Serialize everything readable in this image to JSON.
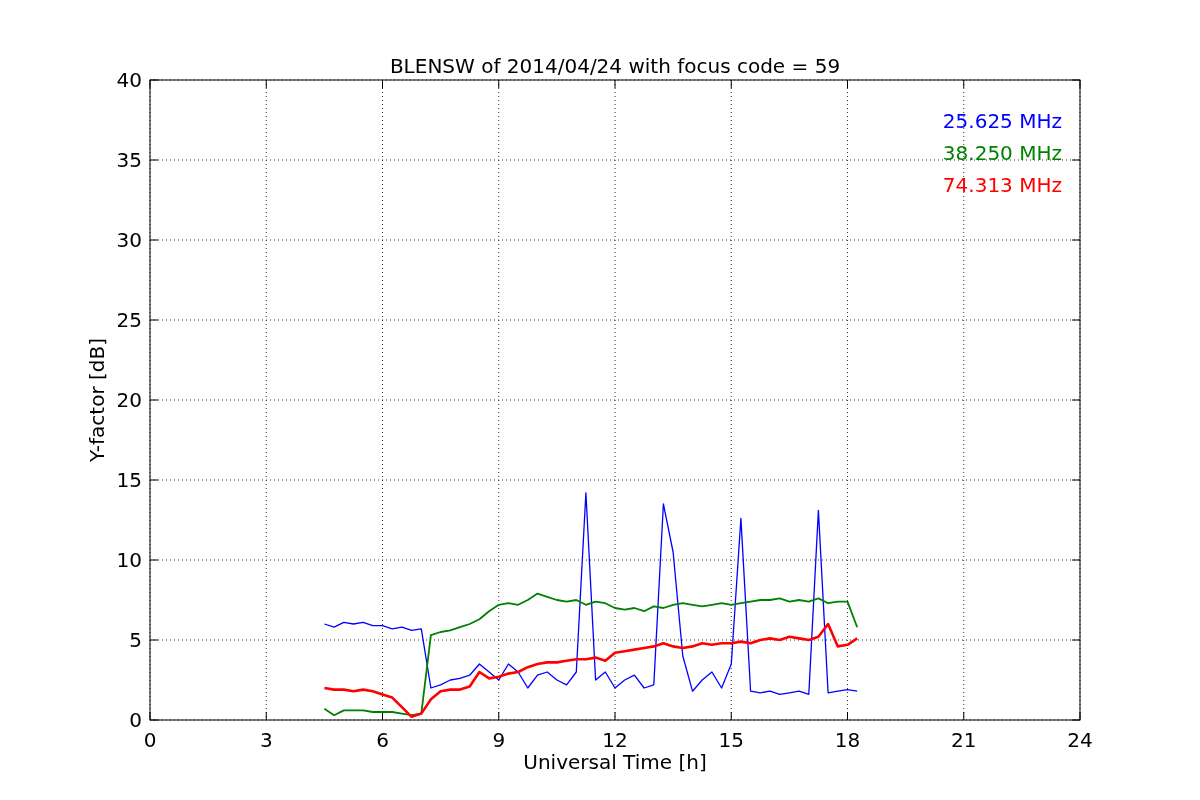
{
  "figure": {
    "chart_data": {
      "type": "line",
      "title": "BLENSW of 2014/04/24 with focus code = 59",
      "xlabel": "Universal Time [h]",
      "ylabel": "Y-factor [dB]",
      "xlim": [
        0,
        24
      ],
      "ylim": [
        0,
        40
      ],
      "xticks": [
        0,
        3,
        6,
        9,
        12,
        15,
        18,
        21,
        24
      ],
      "yticks": [
        0,
        5,
        10,
        15,
        20,
        25,
        30,
        35,
        40
      ],
      "grid": true,
      "x": [
        4.5,
        4.75,
        5,
        5.25,
        5.5,
        5.75,
        6,
        6.25,
        6.5,
        6.75,
        7,
        7.25,
        7.5,
        7.75,
        8,
        8.25,
        8.5,
        8.75,
        9,
        9.25,
        9.5,
        9.75,
        10,
        10.25,
        10.5,
        10.75,
        11,
        11.25,
        11.5,
        11.75,
        12,
        12.25,
        12.5,
        12.75,
        13,
        13.25,
        13.5,
        13.75,
        14,
        14.25,
        14.5,
        14.75,
        15,
        15.25,
        15.5,
        15.75,
        16,
        16.25,
        16.5,
        16.75,
        17,
        17.25,
        17.5,
        17.75,
        18,
        18.25
      ],
      "series": [
        {
          "name": "25.625 MHz",
          "color": "#0000ff",
          "values": [
            6.0,
            5.8,
            6.1,
            6.0,
            6.1,
            5.9,
            5.9,
            5.7,
            5.8,
            5.6,
            5.7,
            2.0,
            2.2,
            2.5,
            2.6,
            2.8,
            3.5,
            3.0,
            2.5,
            3.5,
            3.0,
            2.0,
            2.8,
            3.0,
            2.5,
            2.2,
            3.0,
            14.2,
            2.5,
            3.0,
            2.0,
            2.5,
            2.8,
            2.0,
            2.2,
            13.5,
            10.5,
            4.0,
            1.8,
            2.5,
            3.0,
            2.0,
            3.5,
            12.6,
            1.8,
            1.7,
            1.8,
            1.6,
            1.7,
            1.8,
            1.6,
            13.1,
            1.7,
            1.8,
            1.9,
            1.8
          ]
        },
        {
          "name": "38.250 MHz",
          "color": "#008000",
          "values": [
            0.7,
            0.3,
            0.6,
            0.6,
            0.6,
            0.5,
            0.5,
            0.5,
            0.4,
            0.3,
            0.4,
            5.3,
            5.5,
            5.6,
            5.8,
            6.0,
            6.3,
            6.8,
            7.2,
            7.3,
            7.2,
            7.5,
            7.9,
            7.7,
            7.5,
            7.4,
            7.5,
            7.2,
            7.4,
            7.3,
            7.0,
            6.9,
            7.0,
            6.8,
            7.1,
            7.0,
            7.2,
            7.3,
            7.2,
            7.1,
            7.2,
            7.3,
            7.2,
            7.3,
            7.4,
            7.5,
            7.5,
            7.6,
            7.4,
            7.5,
            7.4,
            7.6,
            7.3,
            7.4,
            7.4,
            5.8
          ]
        },
        {
          "name": "74.313 MHz",
          "color": "#ff0000",
          "values": [
            2.0,
            1.9,
            1.9,
            1.8,
            1.9,
            1.8,
            1.6,
            1.4,
            0.8,
            0.2,
            0.4,
            1.3,
            1.8,
            1.9,
            1.9,
            2.1,
            3.0,
            2.6,
            2.7,
            2.9,
            3.0,
            3.3,
            3.5,
            3.6,
            3.6,
            3.7,
            3.8,
            3.8,
            3.9,
            3.7,
            4.2,
            4.3,
            4.4,
            4.5,
            4.6,
            4.8,
            4.6,
            4.5,
            4.6,
            4.8,
            4.7,
            4.8,
            4.8,
            4.9,
            4.8,
            5.0,
            5.1,
            5.0,
            5.2,
            5.1,
            5.0,
            5.2,
            6.0,
            4.6,
            4.7,
            5.1
          ]
        }
      ]
    }
  }
}
